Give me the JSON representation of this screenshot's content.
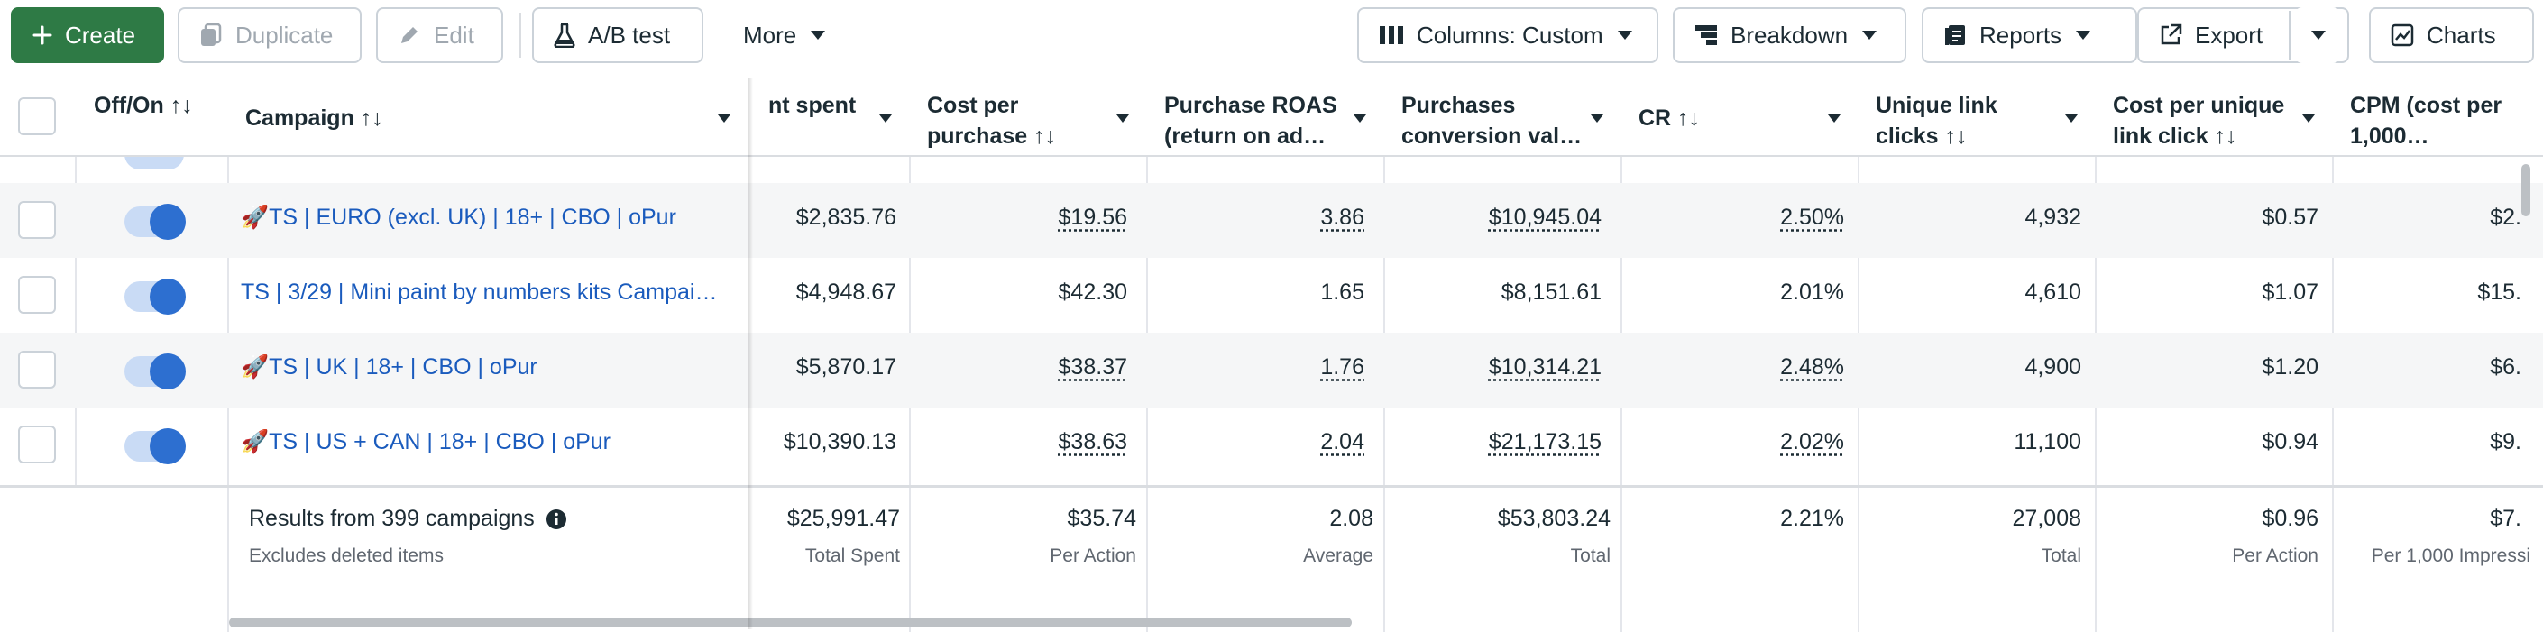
{
  "toolbar": {
    "create": "Create",
    "duplicate": "Duplicate",
    "edit": "Edit",
    "ab_test": "A/B test",
    "more": "More",
    "columns": "Columns: Custom",
    "breakdown": "Breakdown",
    "reports": "Reports",
    "export": "Export",
    "charts": "Charts"
  },
  "colors": {
    "primary": "#2e7a45",
    "link": "#1a5bbd",
    "toggle_on": "#2d6fd0"
  },
  "headers": {
    "offon": "Off/On ↑↓",
    "campaign": "Campaign ↑↓",
    "amount_spent": "nt spent",
    "cost_per_purchase": "Cost per purchase ↑↓",
    "purchase_roas": "Purchase ROAS (return on ad…",
    "purchases_conversion_value": "Purchases conversion val…",
    "cr": "CR ↑↓",
    "unique_link_clicks": "Unique link clicks ↑↓",
    "cost_per_unique_link_click": "Cost per unique link click ↑↓",
    "cpm": "CPM (cost per 1,000…"
  },
  "rows": [
    {
      "campaign": "🚀TS | EURO (excl. UK) | 18+ | CBO | oPur",
      "amount_spent": "$2,835.76",
      "cost_per_purchase": "$19.56",
      "purchase_roas": "3.86",
      "conversion_value": "$10,945.04",
      "cr": "2.50%",
      "unique_link_clicks": "4,932",
      "cost_per_unique_link_click": "$0.57",
      "cpm": "$2."
    },
    {
      "campaign": "TS | 3/29 | Mini paint by numbers kits Campai…",
      "amount_spent": "$4,948.67",
      "cost_per_purchase": "$42.30",
      "purchase_roas": "1.65",
      "conversion_value": "$8,151.61",
      "cr": "2.01%",
      "unique_link_clicks": "4,610",
      "cost_per_unique_link_click": "$1.07",
      "cpm": "$15."
    },
    {
      "campaign": "🚀TS | UK | 18+ | CBO | oPur",
      "amount_spent": "$5,870.17",
      "cost_per_purchase": "$38.37",
      "purchase_roas": "1.76",
      "conversion_value": "$10,314.21",
      "cr": "2.48%",
      "unique_link_clicks": "4,900",
      "cost_per_unique_link_click": "$1.20",
      "cpm": "$6."
    },
    {
      "campaign": "🚀TS | US + CAN | 18+ | CBO | oPur",
      "amount_spent": "$10,390.13",
      "cost_per_purchase": "$38.63",
      "purchase_roas": "2.04",
      "conversion_value": "$21,173.15",
      "cr": "2.02%",
      "unique_link_clicks": "11,100",
      "cost_per_unique_link_click": "$0.94",
      "cpm": "$9."
    }
  ],
  "totals": {
    "results": "Results from 399 campaigns",
    "excludes": "Excludes deleted items",
    "amount_spent": "$25,991.47",
    "amount_spent_sub": "Total Spent",
    "cost_per_purchase": "$35.74",
    "cost_per_purchase_sub": "Per Action",
    "purchase_roas": "2.08",
    "purchase_roas_sub": "Average",
    "conversion_value": "$53,803.24",
    "conversion_value_sub": "Total",
    "cr": "2.21%",
    "unique_link_clicks": "27,008",
    "unique_link_clicks_sub": "Total",
    "cost_per_unique_link_click": "$0.96",
    "cost_per_unique_link_click_sub": "Per Action",
    "cpm": "$7.",
    "cpm_sub": "Per 1,000 Impressi"
  }
}
